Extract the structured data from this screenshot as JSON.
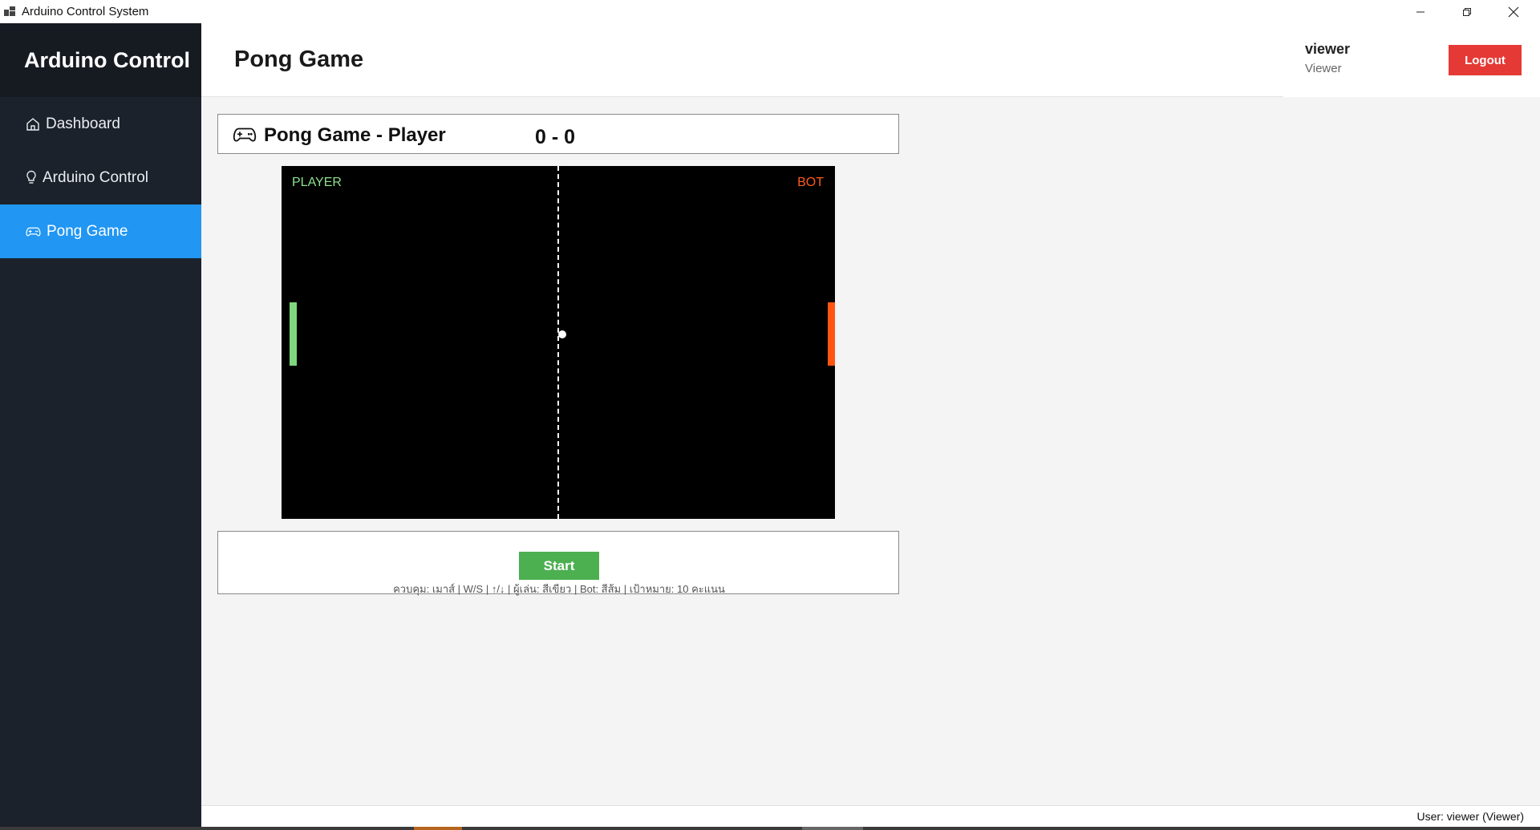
{
  "window": {
    "title": "Arduino Control System"
  },
  "sidebar": {
    "brand": "Arduino Control",
    "items": [
      {
        "label": "Dashboard",
        "icon": "home-icon",
        "active": false
      },
      {
        "label": "Arduino Control",
        "icon": "lightbulb-icon",
        "active": false
      },
      {
        "label": "Pong Game",
        "icon": "gamepad-icon",
        "active": true
      }
    ]
  },
  "header": {
    "title": "Pong Game"
  },
  "user": {
    "name": "viewer",
    "role": "Viewer",
    "logout_label": "Logout"
  },
  "game": {
    "title": "Pong Game - Player",
    "score": "0 - 0",
    "player_label": "PLAYER",
    "bot_label": "BOT",
    "player_color": "#7ed67e",
    "bot_color": "#ff5512"
  },
  "controls": {
    "start_label": "Start",
    "hint": "ควบคุม: เมาส์ | W/S | ↑/↓ | ผู้เล่น: สีเขียว | Bot: สีส้ม | เป้าหมาย: 10 คะแนน"
  },
  "status": {
    "text": "User: viewer (Viewer)"
  },
  "colors": {
    "accent": "#2196f3",
    "danger": "#e53935",
    "success": "#4caf50",
    "sidebar": "#1c222b"
  }
}
